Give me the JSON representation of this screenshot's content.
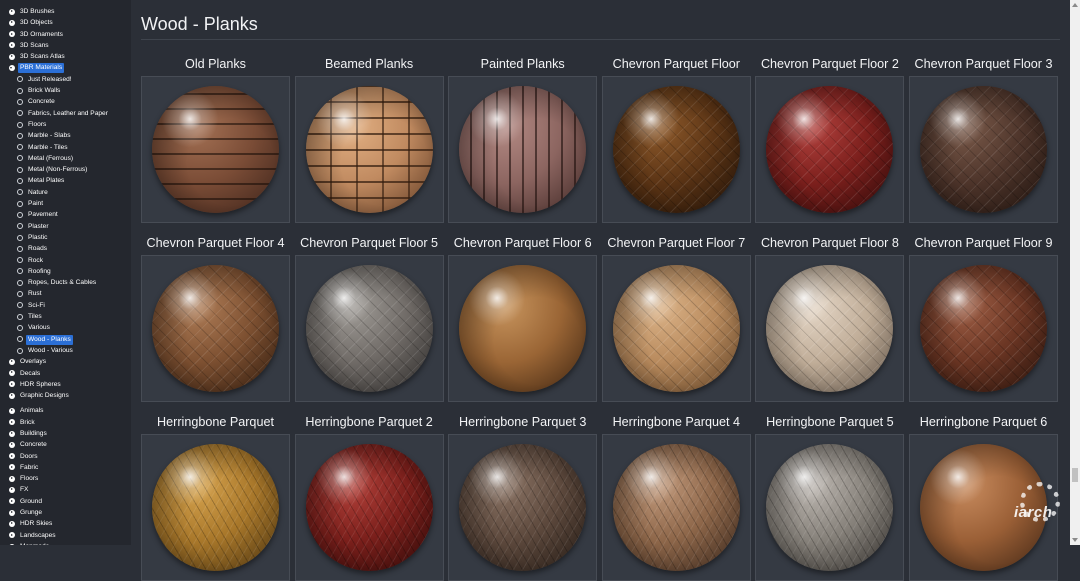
{
  "sidebar": {
    "items": [
      {
        "label": "3D Brushes",
        "level": "top",
        "open": false
      },
      {
        "label": "3D Objects",
        "level": "top",
        "open": false
      },
      {
        "label": "3D Ornaments",
        "level": "top",
        "open": false
      },
      {
        "label": "3D Scans",
        "level": "top",
        "open": false
      },
      {
        "label": "3D Scans Atlas",
        "level": "top",
        "open": false
      },
      {
        "label": "PBR Materials",
        "level": "top",
        "open": true,
        "selected": true
      },
      {
        "label": "Just Released!",
        "level": "sub"
      },
      {
        "label": "Brick Walls",
        "level": "sub"
      },
      {
        "label": "Concrete",
        "level": "sub"
      },
      {
        "label": "Fabrics, Leather and Paper",
        "level": "sub"
      },
      {
        "label": "Floors",
        "level": "sub"
      },
      {
        "label": "Marble - Slabs",
        "level": "sub"
      },
      {
        "label": "Marble - Tiles",
        "level": "sub"
      },
      {
        "label": "Metal (Ferrous)",
        "level": "sub"
      },
      {
        "label": "Metal (Non-Ferrous)",
        "level": "sub"
      },
      {
        "label": "Metal Plates",
        "level": "sub"
      },
      {
        "label": "Nature",
        "level": "sub"
      },
      {
        "label": "Paint",
        "level": "sub"
      },
      {
        "label": "Pavement",
        "level": "sub"
      },
      {
        "label": "Plaster",
        "level": "sub"
      },
      {
        "label": "Plastic",
        "level": "sub"
      },
      {
        "label": "Roads",
        "level": "sub"
      },
      {
        "label": "Rock",
        "level": "sub"
      },
      {
        "label": "Roofing",
        "level": "sub"
      },
      {
        "label": "Ropes, Ducts & Cables",
        "level": "sub"
      },
      {
        "label": "Rust",
        "level": "sub"
      },
      {
        "label": "Sci-Fi",
        "level": "sub"
      },
      {
        "label": "Tiles",
        "level": "sub"
      },
      {
        "label": "Various",
        "level": "sub"
      },
      {
        "label": "Wood - Planks",
        "level": "sub",
        "selected": true
      },
      {
        "label": "Wood - Various",
        "level": "sub"
      },
      {
        "label": "Overlays",
        "level": "top",
        "open": false
      },
      {
        "label": "Decals",
        "level": "top",
        "open": false
      },
      {
        "label": "HDR Spheres",
        "level": "top",
        "open": false
      },
      {
        "label": "Graphic Designs",
        "level": "top",
        "open": false
      },
      {
        "gap": true
      },
      {
        "label": "Animals",
        "level": "top",
        "open": false
      },
      {
        "label": "Brick",
        "level": "top",
        "open": false
      },
      {
        "label": "Buildings",
        "level": "top",
        "open": false
      },
      {
        "label": "Concrete",
        "level": "top",
        "open": false
      },
      {
        "label": "Doors",
        "level": "top",
        "open": false
      },
      {
        "label": "Fabric",
        "level": "top",
        "open": false
      },
      {
        "label": "Floors",
        "level": "top",
        "open": false
      },
      {
        "label": "FX",
        "level": "top",
        "open": false
      },
      {
        "label": "Ground",
        "level": "top",
        "open": false
      },
      {
        "label": "Grunge",
        "level": "top",
        "open": false
      },
      {
        "label": "HDR Skies",
        "level": "top",
        "open": false
      },
      {
        "label": "Landscapes",
        "level": "top",
        "open": false
      },
      {
        "label": "Manmade",
        "level": "top",
        "open": false
      }
    ]
  },
  "main": {
    "title": "Wood - Planks",
    "materials": [
      {
        "title": "Old Planks",
        "colors": [
          "#a47154",
          "#7a4c36",
          "#3b2219"
        ],
        "pattern": "planks-h"
      },
      {
        "title": "Beamed Planks",
        "colors": [
          "#e2b083",
          "#c08a60",
          "#5e3a23"
        ],
        "pattern": "grid"
      },
      {
        "title": "Painted Planks",
        "colors": [
          "#b48a84",
          "#8c6560",
          "#3e2724"
        ],
        "pattern": "planks-v"
      },
      {
        "title": "Chevron Parquet Floor",
        "colors": [
          "#8e5a2b",
          "#5b3415",
          "#1c0f06"
        ],
        "pattern": "chevron"
      },
      {
        "title": "Chevron Parquet Floor 2",
        "colors": [
          "#b3423e",
          "#7b1f1c",
          "#2b0908"
        ],
        "pattern": "chevron"
      },
      {
        "title": "Chevron Parquet Floor 3",
        "colors": [
          "#7a5a4a",
          "#4d342a",
          "#1c110c"
        ],
        "pattern": "chevron"
      },
      {
        "title": "Chevron Parquet Floor 4",
        "colors": [
          "#b07e58",
          "#7d5031",
          "#2d190c"
        ],
        "pattern": "chevron"
      },
      {
        "title": "Chevron Parquet Floor 5",
        "colors": [
          "#a29e99",
          "#6f6a66",
          "#2a2827"
        ],
        "pattern": "chevron"
      },
      {
        "title": "Chevron Parquet Floor 6",
        "colors": [
          "#c8955e",
          "#9a6535",
          "#3b220f"
        ],
        "pattern": "smooth"
      },
      {
        "title": "Chevron Parquet Floor 7",
        "colors": [
          "#ddb58a",
          "#b88a5d",
          "#5a3d22"
        ],
        "pattern": "chevron"
      },
      {
        "title": "Chevron Parquet Floor 8",
        "colors": [
          "#e6d8c8",
          "#c0ad98",
          "#5c5045"
        ],
        "pattern": "chevron"
      },
      {
        "title": "Chevron Parquet Floor 9",
        "colors": [
          "#9e5e45",
          "#6a3523",
          "#24110a"
        ],
        "pattern": "chevron"
      },
      {
        "title": "Herringbone Parquet",
        "colors": [
          "#d7a44f",
          "#a8772a",
          "#46300f"
        ],
        "pattern": "herring"
      },
      {
        "title": "Herringbone Parquet 2",
        "colors": [
          "#b3413a",
          "#7a1f1b",
          "#2a0806"
        ],
        "pattern": "herring"
      },
      {
        "title": "Herringbone Parquet 3",
        "colors": [
          "#8b7465",
          "#5c483c",
          "#221913"
        ],
        "pattern": "herring"
      },
      {
        "title": "Herringbone Parquet 4",
        "colors": [
          "#c29a7c",
          "#8d6649",
          "#35241a"
        ],
        "pattern": "herring"
      },
      {
        "title": "Herringbone Parquet 5",
        "colors": [
          "#bdb7b1",
          "#858079",
          "#302d2a"
        ],
        "pattern": "herring"
      },
      {
        "title": "Herringbone Parquet 6",
        "colors": [
          "#c98c5f",
          "#9a5f36",
          "#3e2413"
        ],
        "pattern": "smooth"
      }
    ]
  },
  "watermark": {
    "text": "iarch"
  }
}
